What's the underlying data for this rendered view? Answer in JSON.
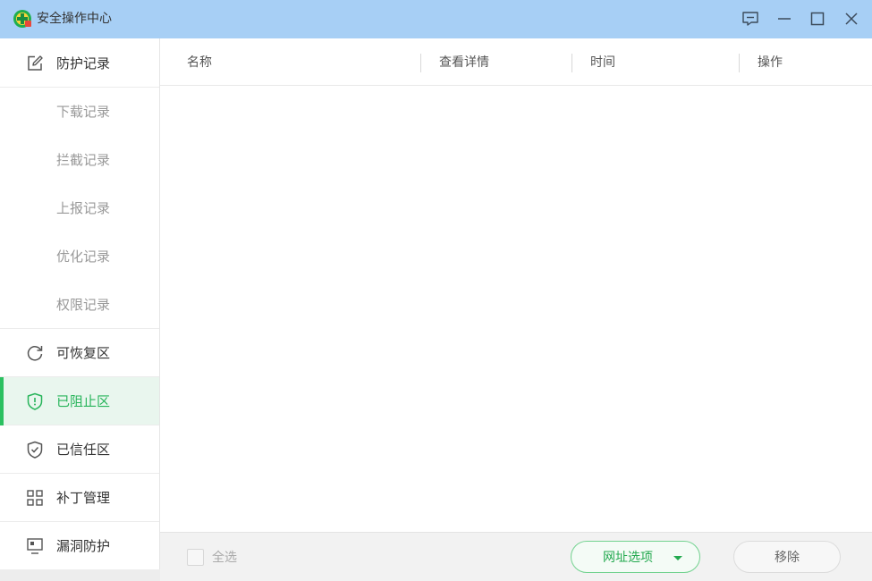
{
  "window": {
    "title": "安全操作中心",
    "controls": [
      "feedback-icon",
      "minimize-icon",
      "maximize-icon",
      "close-icon"
    ]
  },
  "sidebar": {
    "items": [
      {
        "label": "防护记录",
        "icon": "edit-icon",
        "type": "main"
      },
      {
        "label": "下载记录",
        "type": "sub"
      },
      {
        "label": "拦截记录",
        "type": "sub"
      },
      {
        "label": "上报记录",
        "type": "sub"
      },
      {
        "label": "优化记录",
        "type": "sub"
      },
      {
        "label": "权限记录",
        "type": "sub"
      },
      {
        "label": "可恢复区",
        "icon": "refresh-icon",
        "type": "main"
      },
      {
        "label": "已阻止区",
        "icon": "shield-alert-icon",
        "type": "main",
        "active": true
      },
      {
        "label": "已信任区",
        "icon": "shield-check-icon",
        "type": "main"
      },
      {
        "label": "补丁管理",
        "icon": "grid-icon",
        "type": "main"
      },
      {
        "label": "漏洞防护",
        "icon": "monitor-icon",
        "type": "main"
      }
    ]
  },
  "table": {
    "columns": [
      "名称",
      "查看详情",
      "时间",
      "操作"
    ],
    "rows": []
  },
  "footer": {
    "select_all_label": "全选",
    "url_options_label": "网址选项",
    "remove_label": "移除"
  },
  "colors": {
    "titlebar": "#a7cff5",
    "accent": "#2bc060",
    "active_bg": "#e9f6ee"
  }
}
